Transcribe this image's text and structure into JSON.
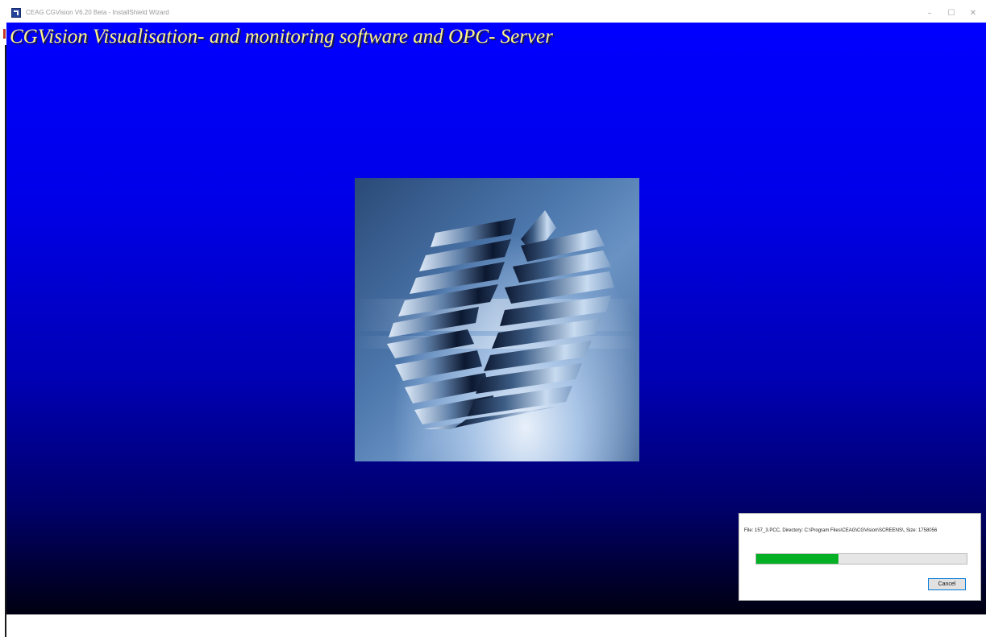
{
  "window": {
    "title": "CEAG CGVision V6.20 Beta - InstallShield Wizard",
    "app_icon": "installshield-icon",
    "controls": {
      "minimize": "–",
      "maximize": "☐",
      "close": "✕"
    }
  },
  "banner": {
    "title": "CGVision Visualisation- and monitoring software and OPC- Server"
  },
  "logo": {
    "icon": "cgvision-logo-icon"
  },
  "progress": {
    "status": "File: 157_3.PCC,  Directory: C:\\Program Files\\CEAG\\CGVision\\SCREENS\\,  Size: 1758056",
    "percent": 39,
    "cancel_label": "Cancel"
  },
  "colors": {
    "background_top": "#0000ff",
    "background_bottom": "#000010",
    "title_text": "#fff68a",
    "progress_fill": "#06b025"
  }
}
